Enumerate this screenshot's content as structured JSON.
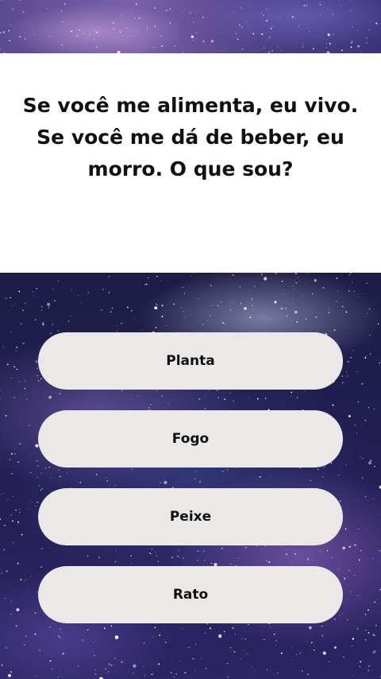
{
  "quiz": {
    "question": "Se você me alimenta, eu vivo. Se você me dá de beber, eu morro. O que sou?",
    "options": [
      {
        "label": "Planta"
      },
      {
        "label": "Fogo"
      },
      {
        "label": "Peixe"
      },
      {
        "label": "Rato"
      }
    ]
  },
  "theme": {
    "background": "galaxy-starfield",
    "card_color": "#ffffff",
    "button_color": "#ebe8e8",
    "text_color": "#111111"
  }
}
